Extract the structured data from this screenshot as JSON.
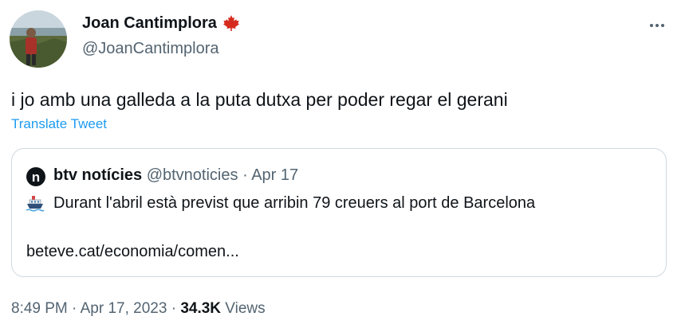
{
  "author": {
    "name": "Joan Cantimplora",
    "flag_icon": "maple-leaf-icon",
    "handle": "@JoanCantimplora"
  },
  "tweet": {
    "text": "i jo amb una galleda a la puta dutxa per poder regar el gerani",
    "translate_label": "Translate Tweet"
  },
  "quoted": {
    "logo_letter": "n",
    "name": "btv notícies",
    "handle": "@btvnoticies",
    "separator": "·",
    "date": "Apr 17",
    "emoji_icon": "ship-icon",
    "text": "Durant l'abril està previst que arribin 79 creuers al port de Barcelona",
    "link": "beteve.cat/economia/comen..."
  },
  "footer": {
    "time": "8:49 PM",
    "separator": "·",
    "date": "Apr 17, 2023",
    "views_count": "34.3K",
    "views_label": "Views"
  },
  "colors": {
    "accent": "#1d9bf0",
    "muted": "#536471",
    "flag_red": "#d52b1e"
  }
}
